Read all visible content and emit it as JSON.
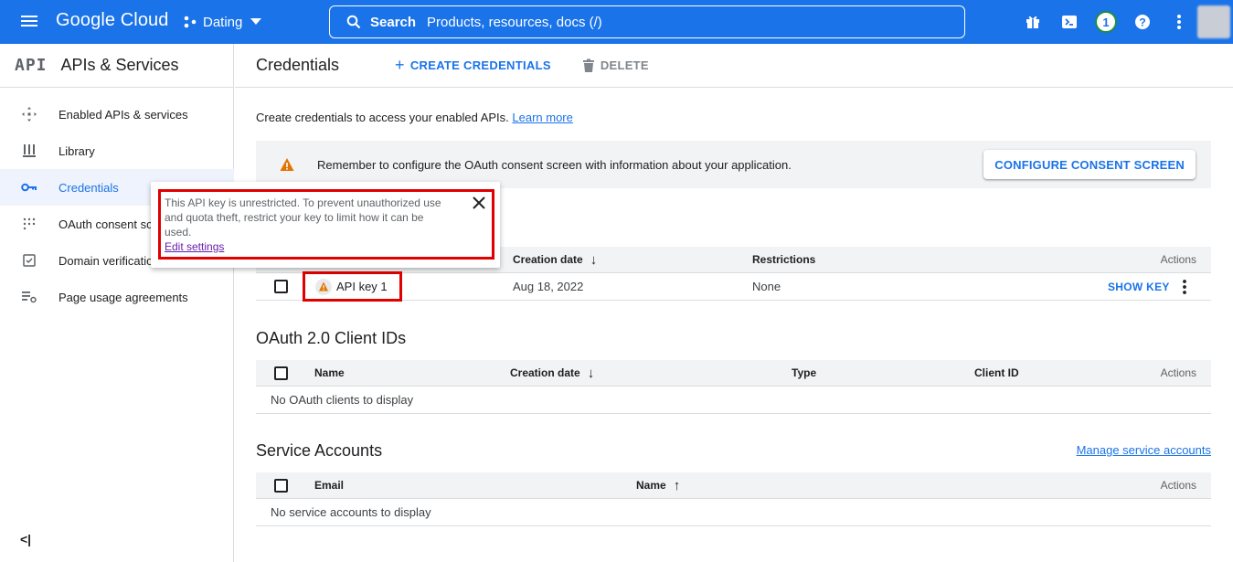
{
  "topbar": {
    "logo": "Google Cloud",
    "project": "Dating",
    "search_label": "Search",
    "search_placeholder": "Products, resources, docs (/)",
    "notification_count": "1",
    "color": "#1a73e8"
  },
  "sidebar": {
    "logo_text": "API",
    "title": "APIs & Services",
    "items": [
      {
        "label": "Enabled APIs & services",
        "icon": "apps-icon"
      },
      {
        "label": "Library",
        "icon": "library-icon"
      },
      {
        "label": "Credentials",
        "icon": "key-icon",
        "active": true
      },
      {
        "label": "OAuth consent screen",
        "icon": "oauth-icon"
      },
      {
        "label": "Domain verification",
        "icon": "domain-check-icon"
      },
      {
        "label": "Page usage agreements",
        "icon": "settings-list-icon"
      }
    ],
    "collapse": "<|"
  },
  "main": {
    "title": "Credentials",
    "create_label": "CREATE CREDENTIALS",
    "delete_label": "DELETE",
    "intro_text": "Create credentials to access your enabled APIs.",
    "learn_more": "Learn more",
    "banner": {
      "message": "Remember to configure the OAuth consent screen with information about your application.",
      "button": "CONFIGURE CONSENT SCREEN"
    },
    "api_keys": {
      "columns": {
        "creation_date": "Creation date",
        "restrictions": "Restrictions",
        "actions": "Actions"
      },
      "rows": [
        {
          "name": "API key 1",
          "creation_date": "Aug 18, 2022",
          "restrictions": "None",
          "action": "SHOW KEY"
        }
      ]
    },
    "oauth": {
      "title": "OAuth 2.0 Client IDs",
      "columns": {
        "name": "Name",
        "creation_date": "Creation date",
        "type": "Type",
        "client_id": "Client ID",
        "actions": "Actions"
      },
      "empty": "No OAuth clients to display"
    },
    "service_accounts": {
      "title": "Service Accounts",
      "manage_link": "Manage service accounts",
      "columns": {
        "email": "Email",
        "name": "Name",
        "actions": "Actions"
      },
      "empty": "No service accounts to display"
    }
  },
  "tooltip": {
    "text": "This API key is unrestricted. To prevent unauthorized use and quota theft, restrict your key to limit how it can be used.",
    "link": "Edit settings"
  },
  "colors": {
    "accent": "#1a73e8",
    "warning": "#e37400",
    "highlight": "#e00000"
  }
}
